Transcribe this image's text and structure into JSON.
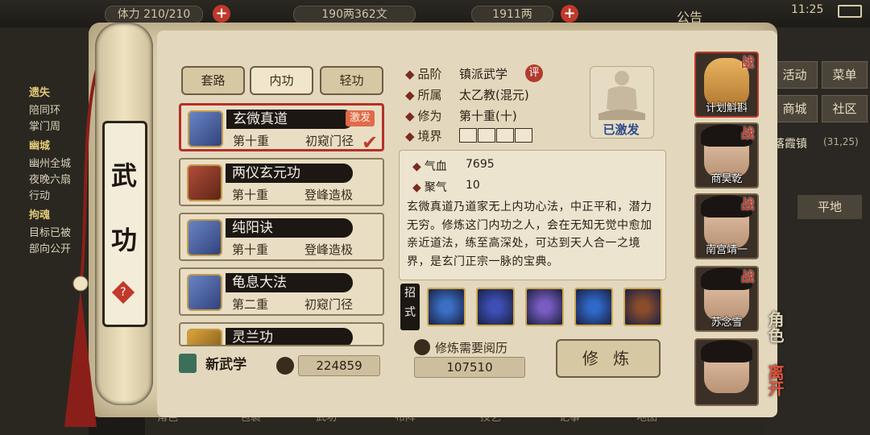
{
  "topbar": {
    "stamina": "体力 210/210",
    "silver": "190两362文",
    "gold": "1911两",
    "announce": "公告",
    "time": "11:25"
  },
  "quests": [
    {
      "title": "遗失",
      "lines": [
        "陪同环",
        "掌门周"
      ]
    },
    {
      "title": "幽城",
      "lines": [
        "幽州全城",
        "夜晚六扇",
        "行动"
      ]
    },
    {
      "title": "拘魂",
      "lines": [
        "目标已被",
        "部向公开"
      ]
    }
  ],
  "right_menu": {
    "activity": "活动",
    "menu": "菜单",
    "shop": "商城",
    "community": "社区",
    "location": "落霞镇",
    "coords": "(31,25)",
    "ground": "平地"
  },
  "spine": {
    "title_top": "武",
    "title_bottom": "功",
    "help": "?"
  },
  "tabs": [
    "套路",
    "内功",
    "轻功"
  ],
  "skills": [
    {
      "name": "玄微真道",
      "level": "第十重",
      "rank": "初窥门径",
      "badge": "激发",
      "selected": true
    },
    {
      "name": "两仪玄元功",
      "level": "第十重",
      "rank": "登峰造极"
    },
    {
      "name": "纯阳诀",
      "level": "第十重",
      "rank": "登峰造极"
    },
    {
      "name": "龟息大法",
      "level": "第二重",
      "rank": "初窥门径"
    },
    {
      "name": "灵兰功",
      "level": "",
      "rank": ""
    }
  ],
  "info": {
    "grade_label": "品阶",
    "grade": "镇派武学",
    "grade_tag": "评",
    "sect_label": "所属",
    "sect": "太乙教(混元)",
    "cult_label": "修为",
    "cult": "第十重(十)",
    "realm_label": "境界",
    "status": "已激发"
  },
  "stats": [
    {
      "label": "气血",
      "value": "7695"
    },
    {
      "label": "聚气",
      "value": "10"
    }
  ],
  "description": "玄微真道乃道家无上内功心法，中正平和，潜力无穷。修炼这门内功之人，会在无知无觉中愈加亲近道法，练至高深处，可达到天人合一之境界，是玄门正宗一脉的宝典。",
  "moves_label": "招式",
  "moves": [
    {
      "icon": "meditation-icon",
      "color": "#3a6fc4"
    },
    {
      "icon": "dao-glyph-icon",
      "color": "#3d4fb5"
    },
    {
      "icon": "monk-aura-icon",
      "color": "#7a5cc0"
    },
    {
      "icon": "lotus-sit-icon",
      "color": "#2f68c7"
    },
    {
      "icon": "sword-light-icon",
      "color": "#8a4c2a"
    }
  ],
  "bottom": {
    "new_skill": "新武学",
    "points": "224859",
    "need_label": "修炼需要阅历",
    "need_value": "107510",
    "train": "修 炼"
  },
  "characters": [
    {
      "name": "计划斛斟",
      "tag": "战"
    },
    {
      "name": "商昊乾",
      "tag": "战"
    },
    {
      "name": "南宫靖一",
      "tag": "战"
    },
    {
      "name": "苏念雪",
      "tag": "战"
    },
    {
      "name": "",
      "tag": ""
    }
  ],
  "side_labels": {
    "role": "角色",
    "leave": "离开"
  },
  "bottom_nav": [
    "角色",
    "包裹",
    "武功",
    "布阵",
    "技艺",
    "记事",
    "地图"
  ]
}
